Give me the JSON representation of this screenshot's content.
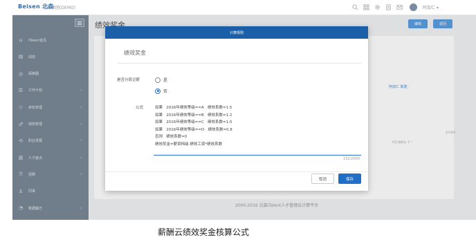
{
  "topbar": {
    "logo": "Beisen 北森",
    "logo_sub": "",
    "company": "北森集团(DEMO)",
    "user_name": "阿加仁 ▾"
  },
  "sidebar": {
    "items": [
      {
        "label": "iTalent首页",
        "icon": "home-icon",
        "has_arrow": false
      },
      {
        "label": "动态",
        "icon": "feed-icon",
        "has_arrow": false
      },
      {
        "label": "探索圈",
        "icon": "explore-icon",
        "has_arrow": false
      },
      {
        "label": "工作计划",
        "icon": "list-icon",
        "has_arrow": true
      },
      {
        "label": "目标管理",
        "icon": "target-icon",
        "has_arrow": true
      },
      {
        "label": "绩效管理",
        "icon": "performance-icon",
        "has_arrow": true
      },
      {
        "label": "职业发展",
        "icon": "career-icon",
        "has_arrow": true
      },
      {
        "label": "人才盘点",
        "icon": "talent-icon",
        "has_arrow": true
      },
      {
        "label": "招聘",
        "icon": "recruit-icon",
        "has_arrow": true
      },
      {
        "label": "同事",
        "icon": "colleague-icon",
        "has_arrow": false
      },
      {
        "label": "数据魔方",
        "icon": "data-icon",
        "has_arrow": true
      }
    ]
  },
  "main": {
    "page_title": "绩效奖金",
    "edit_label": "编辑",
    "back_label": "返回",
    "bg_meta": "阿加仁 新建 ·",
    "bg_count": "0/1000",
    "bg_opts": "不用    按职务    下一"
  },
  "footer": "2000-2016 北森iTalent人才管理云计算平台",
  "modal": {
    "header": "计算规则",
    "title": "绩效奖金",
    "segmented_label": "是否分段记薪",
    "option_yes": "是",
    "option_no": "否",
    "selected": "否",
    "formula_label": "公式",
    "formula_lines": [
      "如果   2016年绩效等级==A   绩效系数=1.5",
      "如果   2016年绩效等级==B   绩效系数=1.2",
      "如果   2016年绩效等级==C   绩效系数=1.0",
      "如果   2016年绩效等级==D   绩效系数=0.8",
      "否则   绩效系数=0",
      "绩效奖金=薪资档级.绩效工资*绩效系数"
    ],
    "char_count": "152/2000",
    "cancel_label": "取消",
    "save_label": "保存"
  },
  "caption": "薪酬云绩效奖金核算公式",
  "colors": {
    "sidebar_bg": "#7a8896",
    "modal_header": "#1a5fa8",
    "primary": "#1f6ec8"
  }
}
